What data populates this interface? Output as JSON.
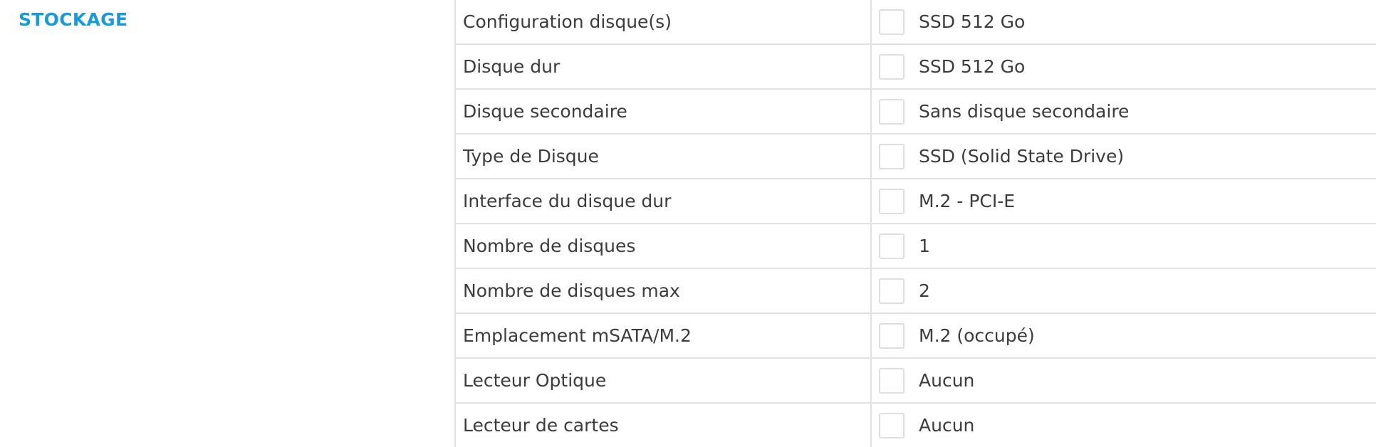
{
  "section": {
    "title": "STOCKAGE"
  },
  "specs": [
    {
      "label": "Configuration disque(s)",
      "value": "SSD 512 Go"
    },
    {
      "label": "Disque dur",
      "value": "SSD 512 Go"
    },
    {
      "label": "Disque secondaire",
      "value": "Sans disque secondaire"
    },
    {
      "label": "Type de Disque",
      "value": "SSD (Solid State Drive)"
    },
    {
      "label": "Interface du disque dur",
      "value": "M.2 - PCI-E"
    },
    {
      "label": "Nombre de disques",
      "value": "1"
    },
    {
      "label": "Nombre de disques max",
      "value": "2"
    },
    {
      "label": "Emplacement mSATA/M.2",
      "value": "M.2 (occupé)"
    },
    {
      "label": "Lecteur Optique",
      "value": "Aucun"
    },
    {
      "label": "Lecteur de cartes",
      "value": "Aucun"
    }
  ],
  "colors": {
    "accent": "#1a9ad6",
    "text": "#3c3c3c",
    "border": "#e2e2e2"
  }
}
